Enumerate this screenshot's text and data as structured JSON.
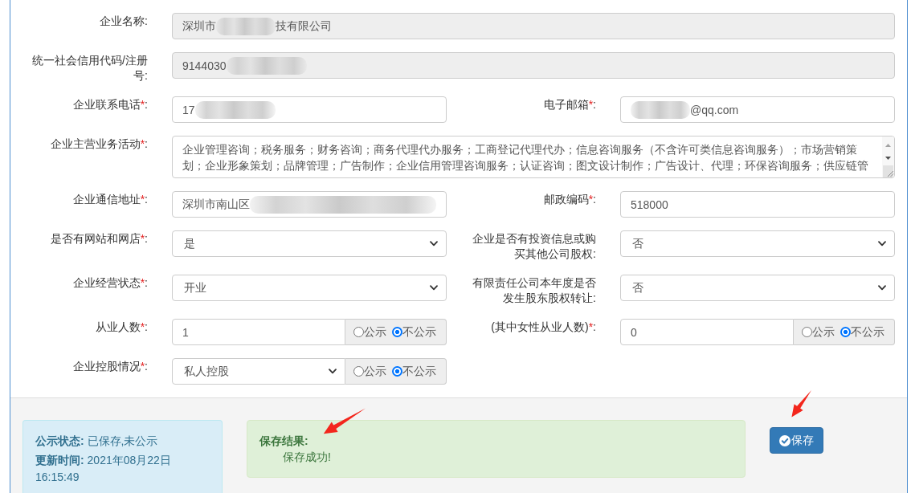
{
  "form": {
    "fields": [
      {
        "kind": "input",
        "wide": true,
        "label": "企业名称:",
        "value_parts": [
          {
            "kind": "text",
            "text": "深圳市"
          },
          {
            "kind": "blur_short"
          },
          {
            "kind": "text",
            "text": "技有限公司"
          }
        ],
        "disabled": true
      },
      {
        "kind": "input",
        "wide": true,
        "label": "统一社会信用代码/注册号:",
        "value_parts": [
          {
            "kind": "text",
            "text": "9144030"
          },
          {
            "kind": "blur_medium"
          }
        ],
        "disabled": true
      },
      {
        "kind": "input",
        "wide": false,
        "label": "企业联系电话",
        "asterisk": "*",
        "label_end": ":",
        "value_parts": [
          {
            "kind": "text",
            "text": "17"
          },
          {
            "kind": "blur_medium"
          }
        ],
        "disabled": false
      },
      {
        "kind": "input",
        "wide": false,
        "label": "电子邮箱",
        "asterisk": "*",
        "label_end": ":",
        "value_parts": [
          {
            "kind": "blur_short"
          },
          {
            "kind": "text",
            "text": "@qq.com"
          }
        ],
        "disabled": false
      },
      {
        "kind": "textarea",
        "wide": true,
        "label": "企业主营业务活动",
        "asterisk": "*",
        "label_end": ":",
        "value": "企业管理咨询；税务服务；财务咨询；商务代理代办服务；工商登记代理代办；信息咨询服务（不含许可类信息咨询服务）；市场营销策划；企业形象策划；品牌管理；广告制作；企业信用管理咨询服务；认证咨询；图文设计制作；广告设计、代理；环保咨询服务；供应链管"
      },
      {
        "kind": "input",
        "wide": false,
        "label": "企业通信地址",
        "asterisk": "*",
        "label_end": ":",
        "value_parts": [
          {
            "kind": "text",
            "text": "深圳市南山区"
          },
          {
            "kind": "blur_long"
          }
        ],
        "disabled": false
      },
      {
        "kind": "input",
        "wide": false,
        "label": "邮政编码",
        "asterisk": "*",
        "label_end": ":",
        "value_parts": [
          {
            "kind": "text",
            "text": "518000"
          }
        ],
        "disabled": false
      },
      {
        "kind": "select",
        "wide": false,
        "label": "是否有网站和网店",
        "asterisk": "*",
        "label_end": ":",
        "value": "是"
      },
      {
        "kind": "select",
        "wide": false,
        "label": "企业是否有投资信息或购买其他公司股权:",
        "value": "否"
      },
      {
        "kind": "select",
        "wide": false,
        "label": "企业经营状态",
        "asterisk": "*",
        "label_end": ":",
        "value": "开业"
      },
      {
        "kind": "select",
        "wide": false,
        "label": "有限责任公司本年度是否发生股东股权转让:",
        "value": "否"
      },
      {
        "kind": "input",
        "wide": false,
        "label": "从业人数",
        "asterisk": "*",
        "label_end": ":",
        "value_parts": [
          {
            "kind": "text",
            "text": "1"
          }
        ],
        "disabled": false,
        "disclosure": {
          "options": [
            {
              "label": "公示",
              "selected": false
            },
            {
              "label": "不公示",
              "selected": true
            }
          ]
        }
      },
      {
        "kind": "input",
        "wide": false,
        "label": "(其中女性从业人数)",
        "asterisk": "*",
        "label_end": ":",
        "value_parts": [
          {
            "kind": "text",
            "text": "0"
          }
        ],
        "disabled": false,
        "disclosure": {
          "options": [
            {
              "label": "公示",
              "selected": false
            },
            {
              "label": "不公示",
              "selected": true
            }
          ]
        }
      },
      {
        "kind": "select",
        "wide": false,
        "label": "企业控股情况",
        "asterisk": "*",
        "label_end": ":",
        "value": "私人控股",
        "disclosure": {
          "options": [
            {
              "label": "公示",
              "selected": false
            },
            {
              "label": "不公示",
              "selected": true
            }
          ]
        }
      }
    ]
  },
  "status_panel": {
    "lines": [
      "**公示状态:** 已保存,未公示",
      "**更新时间:** 2021年08月22日 16:15:49"
    ]
  },
  "result_panel": {
    "title": "保存结果:",
    "message": "保存成功!"
  },
  "save_button": {
    "label": "保存"
  }
}
